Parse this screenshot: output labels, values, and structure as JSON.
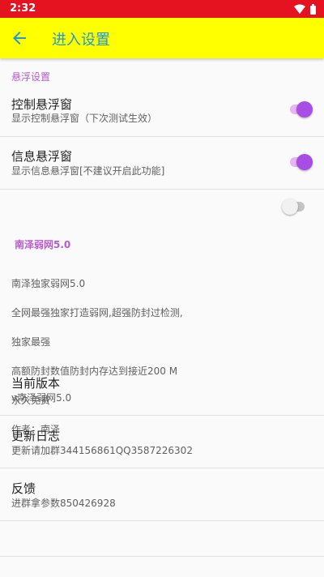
{
  "status_bar": {
    "time": "2:32"
  },
  "app_bar": {
    "title": "进入设置",
    "back_icon": "arrow-back-icon"
  },
  "float_section": {
    "header": "悬浮设置"
  },
  "control_float": {
    "title": "控制悬浮窗",
    "summary": "显示控制悬浮窗（下次测试生效）",
    "enabled": true
  },
  "info_float": {
    "title": "信息悬浮窗",
    "summary": "显示信息悬浮窗[不建议开启此功能]",
    "enabled": true
  },
  "extra_toggle": {
    "enabled": false
  },
  "about": {
    "title": "南泽弱网5.0",
    "lines": [
      "南泽独家弱网5.0",
      "全网最强独家打造弱网,超强防封过检测,",
      "独家最强",
      "高额防封数值防封内存达到接近200 M",
      "永久免费",
      "作者：南泽"
    ]
  },
  "version": {
    "title": "当前版本",
    "summary": "v南泽弱网5.0"
  },
  "changelog": {
    "title": "更新日志",
    "summary": "更新请加群344156861QQ3587226302"
  },
  "feedback": {
    "title": "反馈",
    "summary": "进群拿参数850426928"
  },
  "colors": {
    "status_bar": "#e5121f",
    "app_bar": "#ffff00",
    "title": "#1e9bd4",
    "accent": "#a84ee6",
    "section": "#b75bd3"
  }
}
